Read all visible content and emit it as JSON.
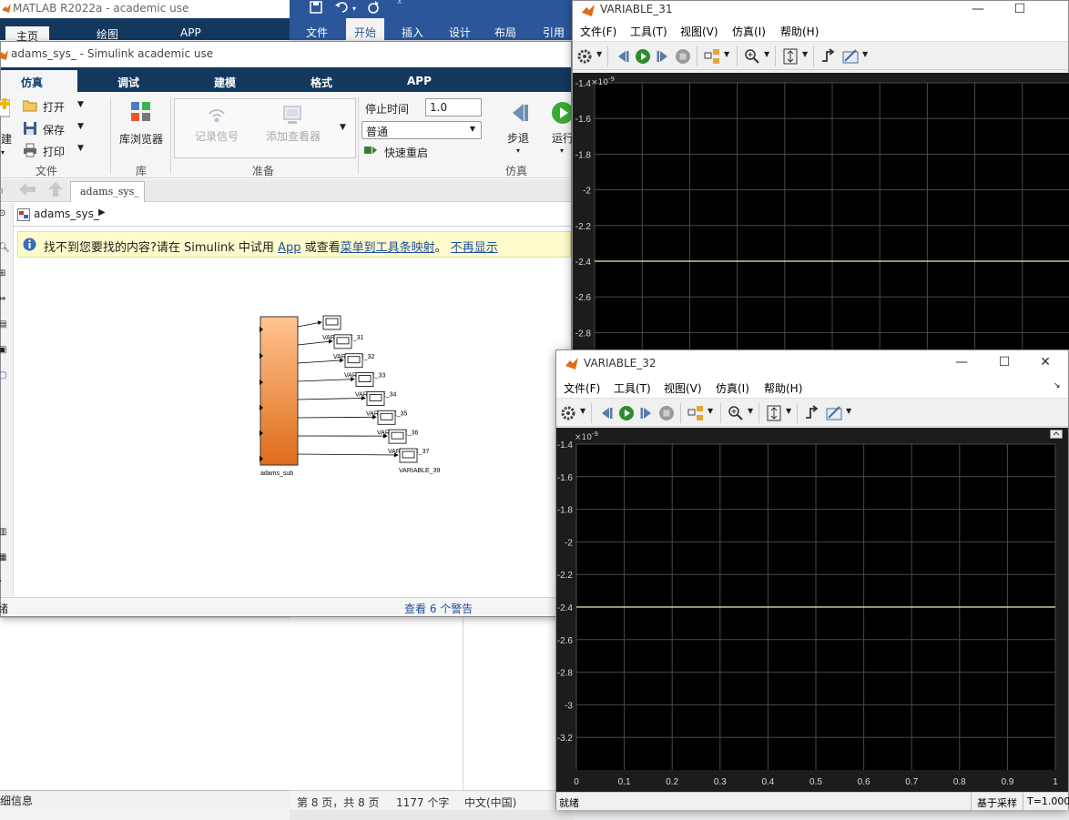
{
  "matlab": {
    "title": "MATLAB R2022a - academic use",
    "tabs": [
      "主页",
      "绘图",
      "APP"
    ],
    "detail_label": "详细信息"
  },
  "word": {
    "tabs": [
      "文件",
      "开始",
      "插入",
      "设计",
      "布局",
      "引用"
    ],
    "status": {
      "page": "第 8 页，共 8 页",
      "words": "1177 个字",
      "lang": "中文(中国)"
    }
  },
  "simulink": {
    "title": "adams_sys_ - Simulink academic use",
    "tabs": [
      "仿真",
      "调试",
      "建模",
      "格式",
      "APP"
    ],
    "file_group": {
      "new": "建",
      "open": "打开",
      "save": "保存",
      "print": "打印",
      "label": "文件"
    },
    "lib_group": {
      "browser": "库浏览器",
      "label": "库"
    },
    "prepare_group": {
      "record": "记录信号",
      "add_viewer": "添加查看器",
      "label": "准备"
    },
    "stop_time_label": "停止时间",
    "stop_time": "1.0",
    "sim_mode": "普通",
    "fast_restart": "快速重启",
    "step_back": "步退",
    "run": "运行",
    "sim_group_label": "仿真",
    "doc_tab": "adams_sys_",
    "breadcrumb": "adams_sys_",
    "banner": {
      "text1": "找不到您要找的内容?请在 Simulink 中试用 ",
      "app": "App",
      "text2": " 或查看",
      "link1": "菜单到工具条映射",
      "sep": "。",
      "link2": "不再显示"
    },
    "block_main_label": "adams_sub",
    "scope_blocks": [
      {
        "label": "VARIABLE_31"
      },
      {
        "label": "VARIABLE_32"
      },
      {
        "label": "VARIABLE_33"
      },
      {
        "label": "VARIABLE_34"
      },
      {
        "label": "VARIABLE_35"
      },
      {
        "label": "VARIABLE_36"
      },
      {
        "label": "VARIABLE_37"
      },
      {
        "label": "VARIABLE_39"
      }
    ],
    "status_left": "绪",
    "status_warnings": "查看 6 个警告"
  },
  "scope1": {
    "title": "VARIABLE_31",
    "menus": [
      "文件(F)",
      "工具(T)",
      "视图(V)",
      "仿真(I)",
      "帮助(H)"
    ],
    "exponent": "×10",
    "exponent_power": "-9",
    "y_ticks": [
      "-1.4",
      "-1.6",
      "-1.8",
      "-2",
      "-2.2",
      "-2.4",
      "-2.6",
      "-2.8"
    ]
  },
  "scope2": {
    "title": "VARIABLE_32",
    "menus": [
      "文件(F)",
      "工具(T)",
      "视图(V)",
      "仿真(I)",
      "帮助(H)"
    ],
    "exponent": "×10",
    "exponent_power": "-9",
    "y_ticks": [
      "-1.4",
      "-1.6",
      "-1.8",
      "-2",
      "-2.2",
      "-2.4",
      "-2.6",
      "-2.8",
      "-3",
      "-3.2"
    ],
    "x_ticks": [
      "0",
      "0.1",
      "0.2",
      "0.3",
      "0.4",
      "0.5",
      "0.6",
      "0.7",
      "0.8",
      "0.9",
      "1"
    ],
    "status_left": "就绪",
    "status_sample": "基于采样",
    "status_time": "T=1.000"
  },
  "chart_data": [
    {
      "type": "line",
      "title": "VARIABLE_31",
      "ylim": [
        -2.9,
        -1.4
      ],
      "y_scale_note": "×10^-9",
      "series": [
        {
          "x": [
            0,
            1
          ],
          "y": [
            -2.4,
            -2.4
          ]
        }
      ],
      "grid": true
    },
    {
      "type": "line",
      "title": "VARIABLE_32",
      "xlim": [
        0,
        1
      ],
      "ylim": [
        -3.4,
        -1.4
      ],
      "y_scale_note": "×10^-9",
      "series": [
        {
          "x": [
            0,
            1
          ],
          "y": [
            -2.4,
            -2.4
          ]
        }
      ],
      "grid": true
    }
  ],
  "colors": {
    "simulink_blue": "#12385e",
    "word_blue": "#2b579a",
    "trace": "#f0eeb0",
    "plot_bg": "#000000"
  }
}
